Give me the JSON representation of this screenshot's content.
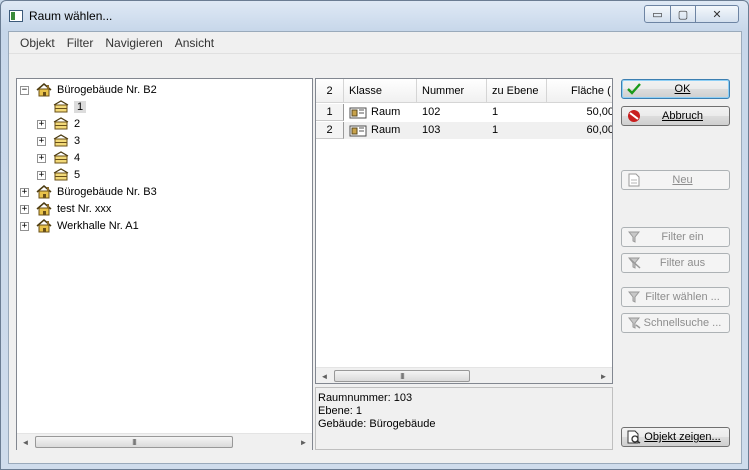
{
  "window": {
    "title": "Raum wählen...",
    "controls": {
      "minimize": "▭",
      "maximize": "▢",
      "close": "✕"
    }
  },
  "menu": [
    "Objekt",
    "Filter",
    "Navigieren",
    "Ansicht"
  ],
  "tree": {
    "nodes": [
      {
        "label": "Bürogebäude Nr. B2",
        "expander": "−",
        "icon": "building-icon"
      },
      {
        "label": "1",
        "icon": "floor-icon",
        "selected": true
      },
      {
        "label": "2",
        "expander": "+",
        "icon": "floor-icon"
      },
      {
        "label": "3",
        "expander": "+",
        "icon": "floor-icon"
      },
      {
        "label": "4",
        "expander": "+",
        "icon": "floor-icon"
      },
      {
        "label": "5",
        "expander": "+",
        "icon": "floor-icon"
      },
      {
        "label": "Bürogebäude Nr. B3",
        "expander": "+",
        "icon": "building-icon"
      },
      {
        "label": "test Nr. xxx",
        "expander": "+",
        "icon": "building-icon"
      },
      {
        "label": "Werkhalle Nr. A1",
        "expander": "+",
        "icon": "building-icon"
      }
    ]
  },
  "grid": {
    "count": "2",
    "columns": [
      "Klasse",
      "Nummer",
      "zu Ebene",
      "Fläche ( m"
    ],
    "rows": [
      {
        "num": "1",
        "klasse": "Raum",
        "nummer": "102",
        "ebene": "1",
        "flaeche": "50,00"
      },
      {
        "num": "2",
        "klasse": "Raum",
        "nummer": "103",
        "ebene": "1",
        "flaeche": "60,00"
      }
    ]
  },
  "info": {
    "raumnummer": "Raumnummer: 103",
    "ebene": "Ebene:   1",
    "gebaeude": "Gebäude:  Bürogebäude"
  },
  "buttons": {
    "ok": "OK",
    "abbruch": "Abbruch",
    "neu": "Neu",
    "filter_ein": "Filter ein",
    "filter_aus": "Filter aus",
    "filter_waehlen": "Filter wählen ...",
    "schnellsuche": "Schnellsuche ...",
    "objekt_zeigen": "Objekt zeigen..."
  },
  "scroll": {
    "left": "◄",
    "right": "►",
    "thumb": "III"
  },
  "colors": {
    "ok_check": "#1a9a1a",
    "cancel_red": "#c81e1e"
  }
}
